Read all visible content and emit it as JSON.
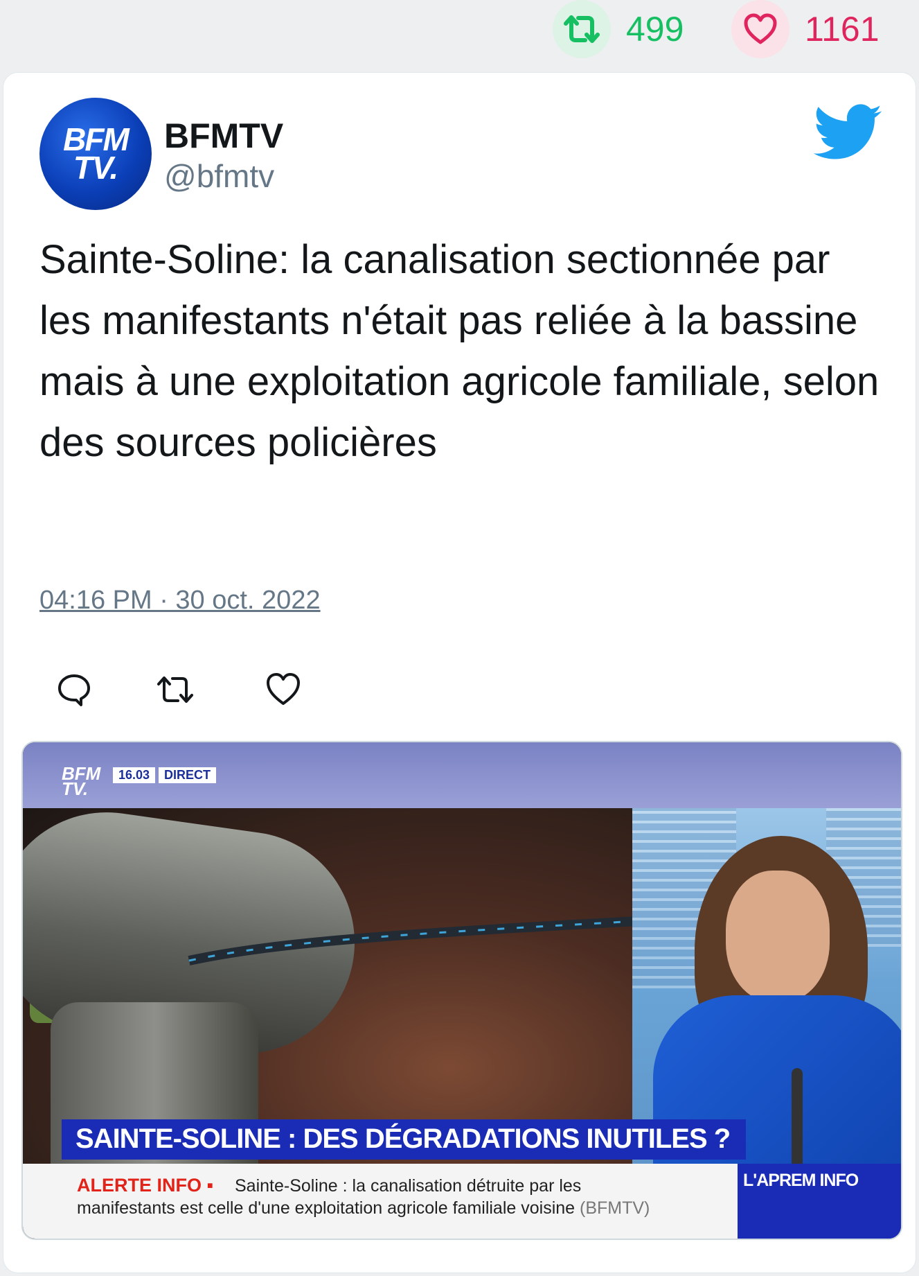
{
  "stats": {
    "retweet_icon": "retweet-icon",
    "retweets": "499",
    "like_icon": "heart-icon",
    "likes": "1161"
  },
  "tweet": {
    "avatar_line1": "BFM",
    "avatar_line2": "TV.",
    "display_name": "BFMTV",
    "handle": "@bfmtv",
    "text": "Sainte-Soline: la canalisation sectionnée par les manifestants n'était pas reliée à la bassine mais à une exploitation agricole familiale, selon des sources policières",
    "timestamp": "04:16 PM · 30 oct. 2022",
    "actions": [
      "reply-icon",
      "retweet-icon",
      "heart-icon"
    ]
  },
  "media": {
    "logo_line1": "BFM",
    "logo_line2": "TV.",
    "clock": "16.03",
    "live": "DIRECT",
    "headline": "SAINTE-SOLINE : DES DÉGRADATIONS INUTILES ?",
    "ticker_label": "ALERTE INFO ▪",
    "ticker_line1": "Sainte-Soline : la canalisation détruite par les",
    "ticker_line2": "manifestants est celle d'une exploitation agricole familiale voisine",
    "ticker_source": "(BFMTV)",
    "show_name": "L'APREM INFO"
  },
  "colors": {
    "retweet_green": "#17bf63",
    "like_red": "#e0245e",
    "twitter_blue": "#1da1f2",
    "bfm_blue": "#1a2bb5"
  }
}
